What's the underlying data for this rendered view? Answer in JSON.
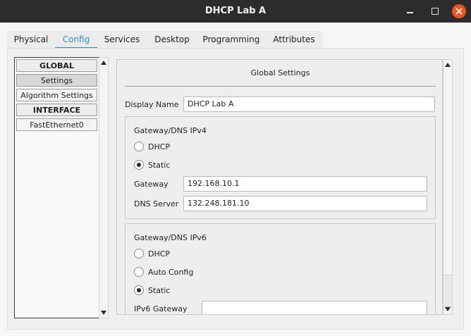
{
  "window": {
    "title": "DHCP Lab A"
  },
  "tabs": [
    "Physical",
    "Config",
    "Services",
    "Desktop",
    "Programming",
    "Attributes"
  ],
  "active_tab": "Config",
  "sidebar": {
    "items": [
      {
        "label": "GLOBAL",
        "type": "header"
      },
      {
        "label": "Settings",
        "type": "item",
        "selected": true
      },
      {
        "label": "Algorithm Settings",
        "type": "item"
      },
      {
        "label": "INTERFACE",
        "type": "header"
      },
      {
        "label": "FastEthernet0",
        "type": "item"
      }
    ]
  },
  "global_settings": {
    "title": "Global Settings",
    "display_name_label": "Display Name",
    "display_name_value": "DHCP Lab A",
    "ipv4": {
      "title": "Gateway/DNS IPv4",
      "dhcp_label": "DHCP",
      "static_label": "Static",
      "mode": "Static",
      "gateway_label": "Gateway",
      "gateway_value": "192.168.10.1",
      "dns_label": "DNS Server",
      "dns_value": "132.248.181.10"
    },
    "ipv6": {
      "title": "Gateway/DNS IPv6",
      "dhcp_label": "DHCP",
      "auto_label": "Auto Config",
      "static_label": "Static",
      "mode": "Static",
      "gateway_label": "IPv6 Gateway",
      "gateway_value": ""
    }
  },
  "colors": {
    "accent": "#2d8cc3",
    "close_button": "#e95420",
    "titlebar": "#2c2c2c"
  },
  "icons": {
    "minimize": "minimize-icon",
    "maximize": "maximize-icon",
    "close": "close-icon"
  }
}
